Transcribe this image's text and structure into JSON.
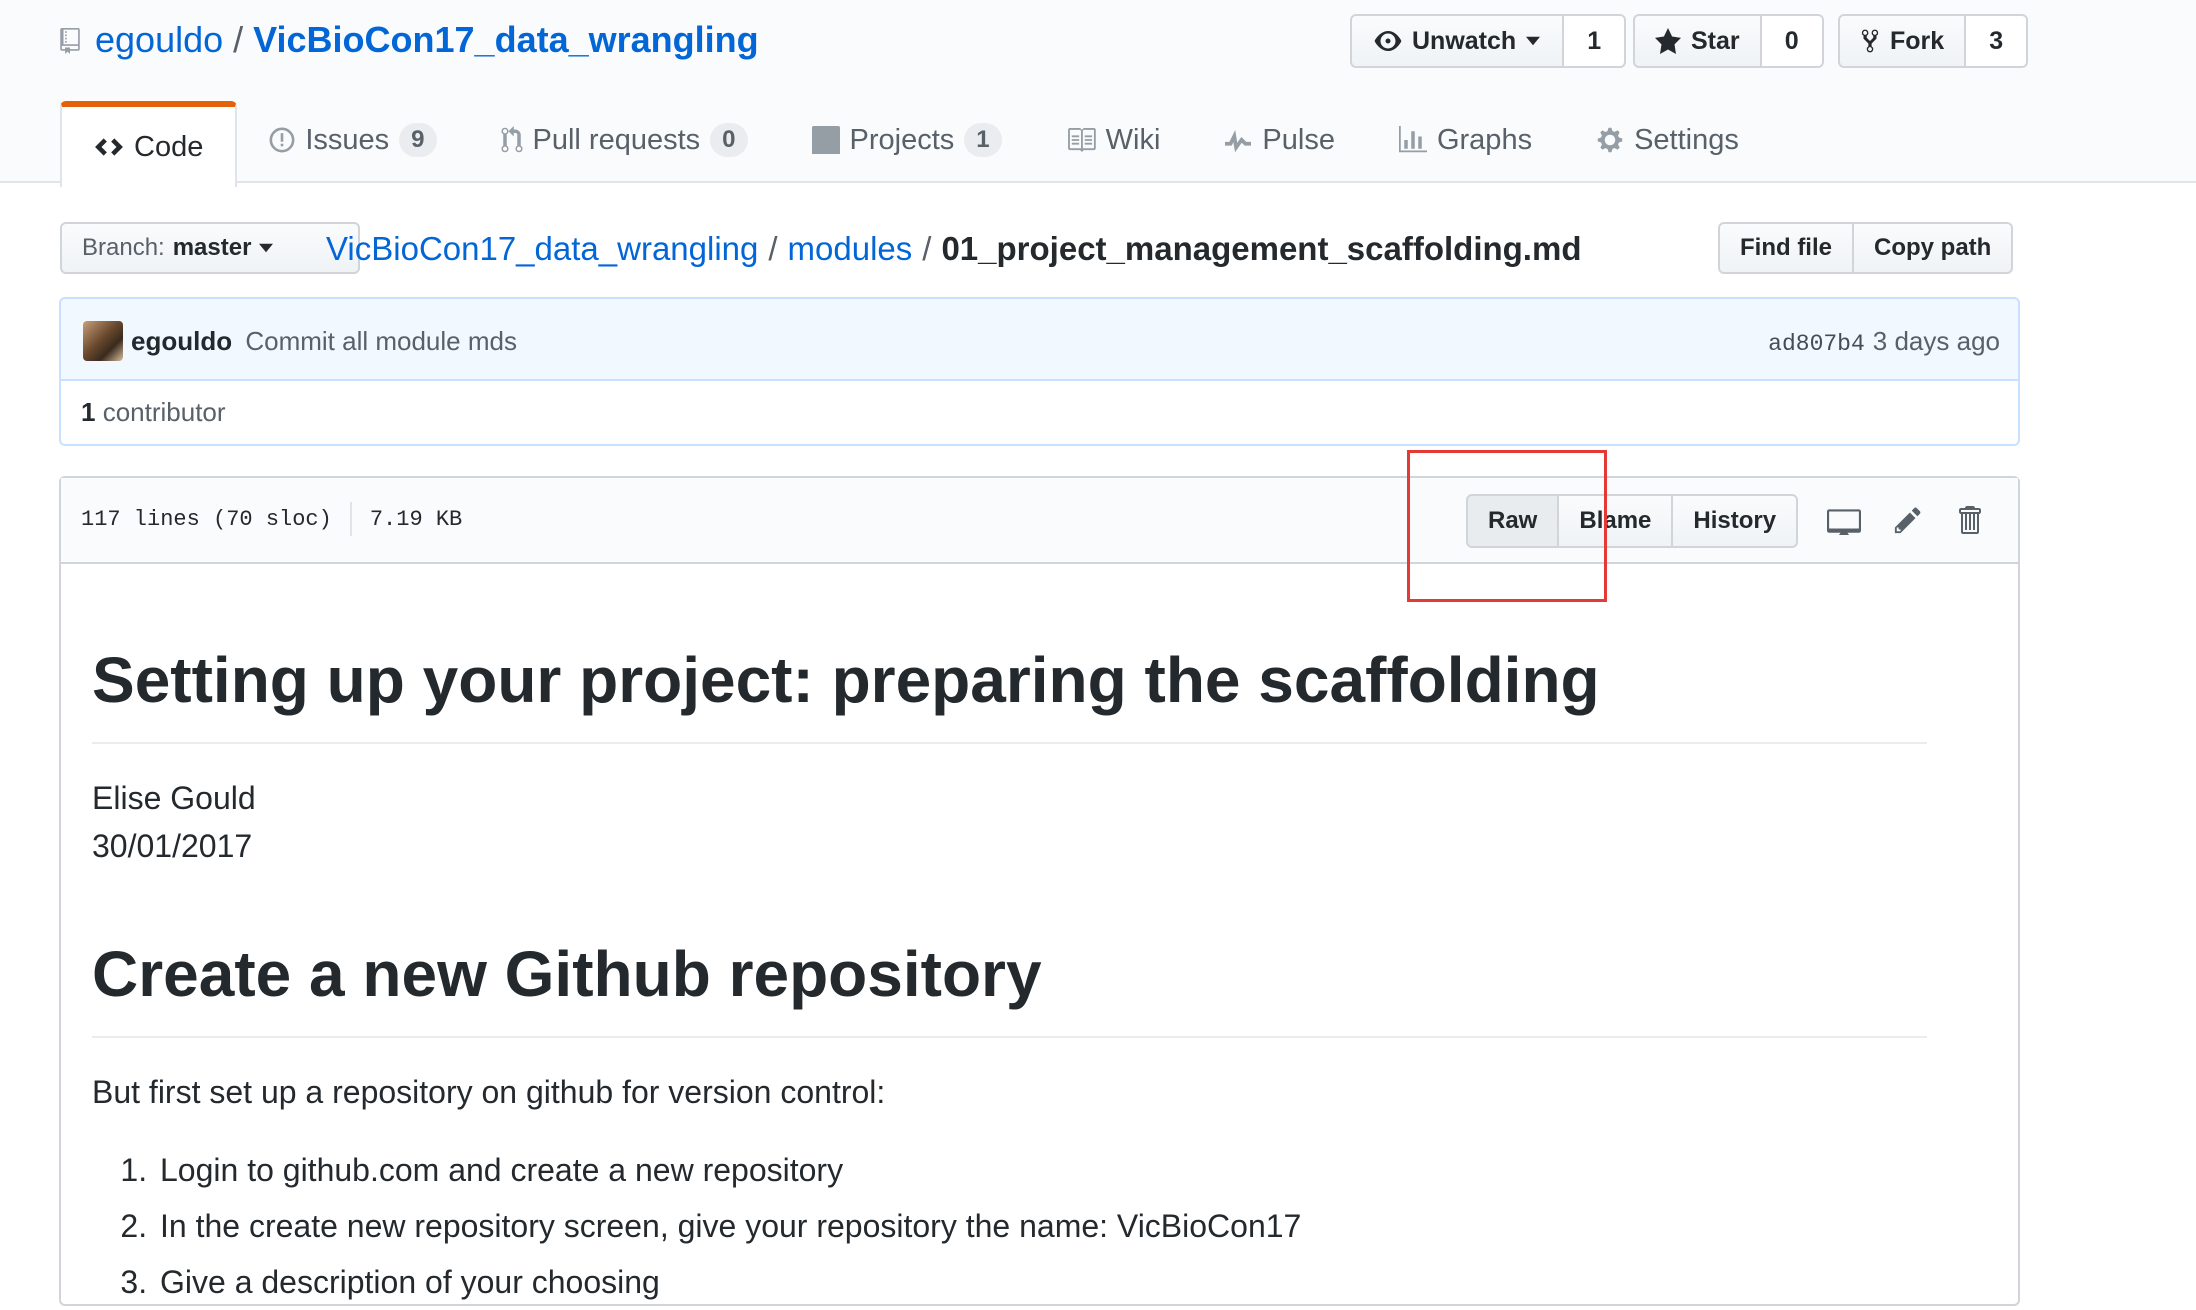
{
  "repo": {
    "owner": "egouldo",
    "separator": "/",
    "name": "VicBioCon17_data_wrangling"
  },
  "header_actions": {
    "unwatch": {
      "label": "Unwatch",
      "count": "1"
    },
    "star": {
      "label": "Star",
      "count": "0"
    },
    "fork": {
      "label": "Fork",
      "count": "3"
    }
  },
  "tabs": [
    {
      "label": "Code",
      "icon": "code-icon",
      "selected": true
    },
    {
      "label": "Issues",
      "icon": "issue-icon",
      "count": "9"
    },
    {
      "label": "Pull requests",
      "icon": "pull-request-icon",
      "count": "0"
    },
    {
      "label": "Projects",
      "icon": "project-icon",
      "count": "1"
    },
    {
      "label": "Wiki",
      "icon": "book-icon"
    },
    {
      "label": "Pulse",
      "icon": "pulse-icon"
    },
    {
      "label": "Graphs",
      "icon": "graph-icon"
    },
    {
      "label": "Settings",
      "icon": "gear-icon"
    }
  ],
  "branch": {
    "prefix": "Branch:",
    "name": "master"
  },
  "breadcrumb": {
    "repo": "VicBioCon17_data_wrangling",
    "folder": "modules",
    "file": "01_project_management_scaffolding.md",
    "sep": "/"
  },
  "file_nav": {
    "find_file": "Find file",
    "copy_path": "Copy path"
  },
  "commit": {
    "author": "egouldo",
    "message": "Commit all module mds",
    "sha": "ad807b4",
    "time": "3 days ago"
  },
  "contributors": {
    "count": "1",
    "label": "contributor"
  },
  "file": {
    "lines": "117 lines (70 sloc)",
    "size": "7.19 KB",
    "raw": "Raw",
    "blame": "Blame",
    "history": "History"
  },
  "highlight": {
    "color": "#e53935"
  },
  "markdown": {
    "h1": "Setting up your project: preparing the scaffolding",
    "author": "Elise Gould",
    "date": "30/01/2017",
    "h2": "Create a new Github repository",
    "intro": "But first set up a repository on github for version control:",
    "steps": [
      "Login to github.com and create a new repository",
      "In the create new repository screen, give your repository the name: VicBioCon17",
      "Give a description of your choosing"
    ]
  }
}
